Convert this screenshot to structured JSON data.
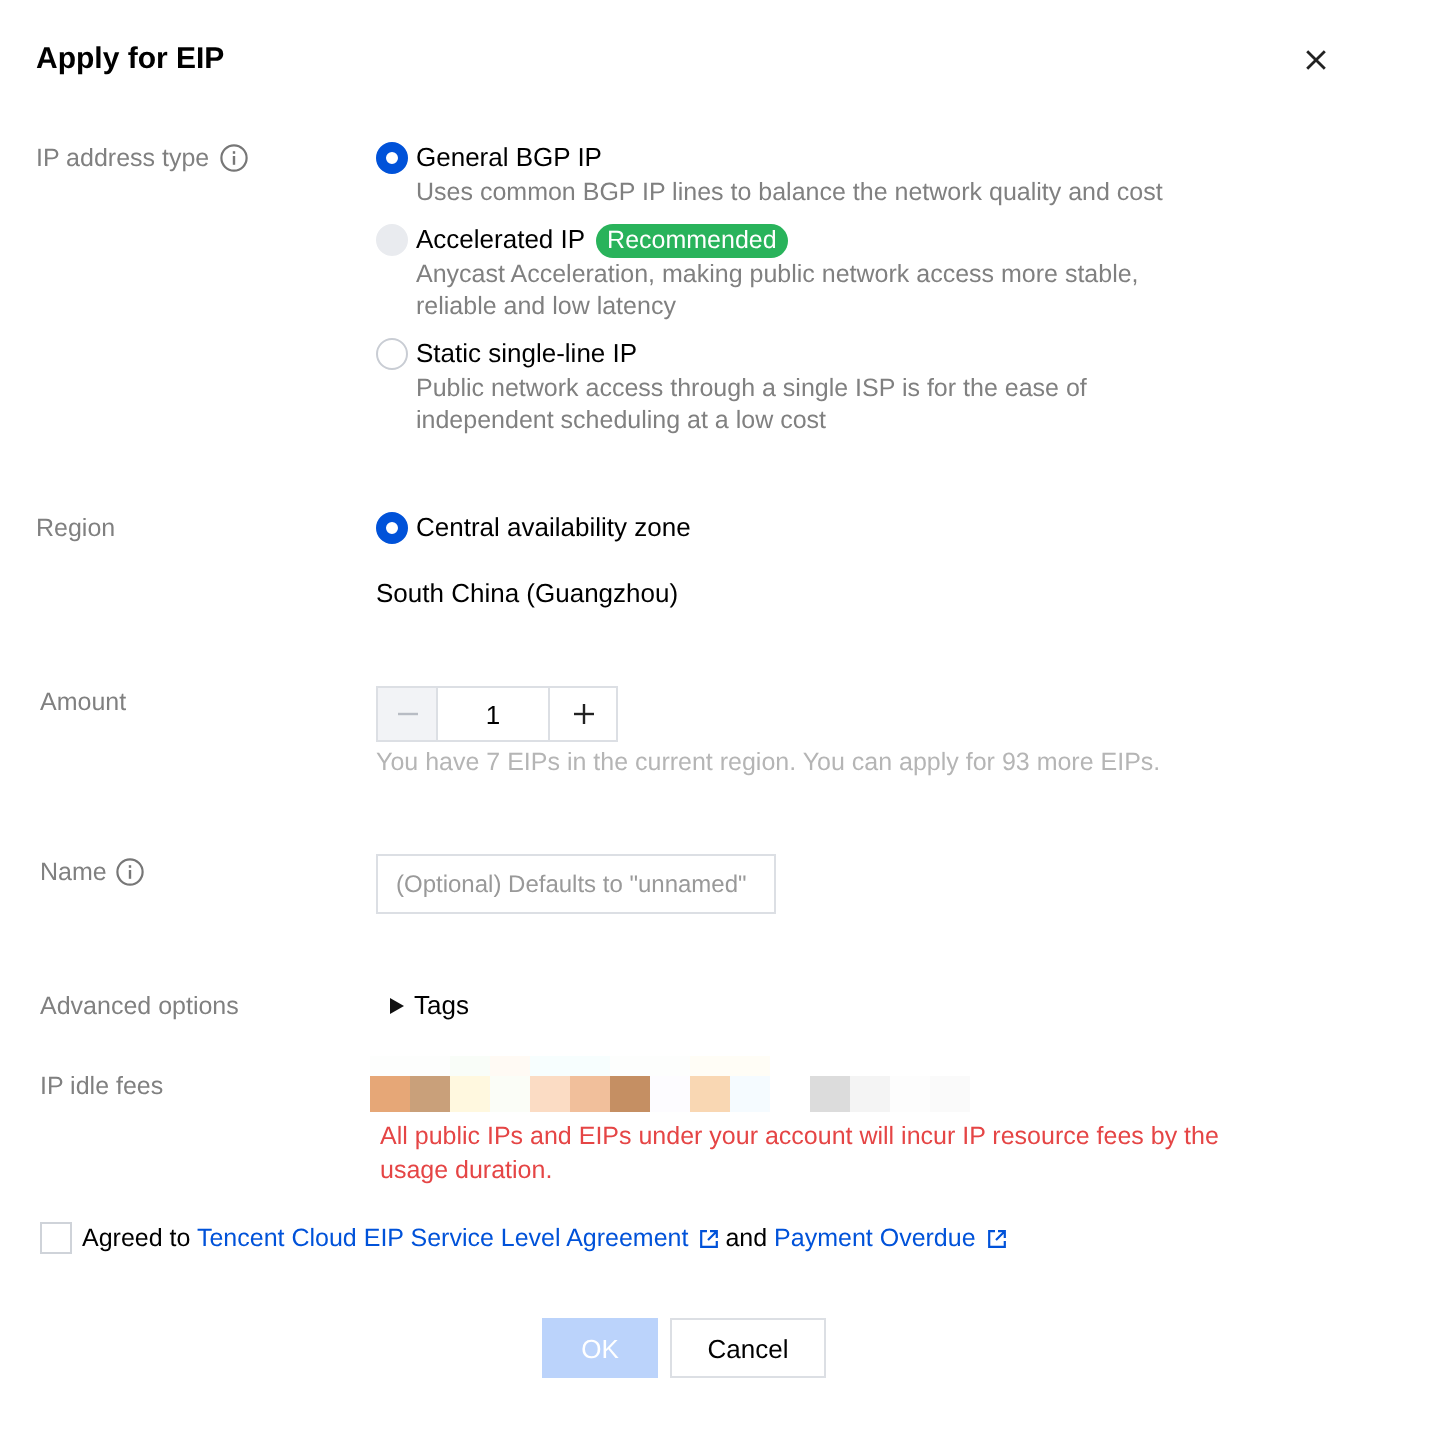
{
  "dialog": {
    "title": "Apply for EIP"
  },
  "ip_address_type": {
    "label": "IP address type",
    "info": true,
    "options": [
      {
        "label": "General BGP IP",
        "description": "Uses common BGP IP lines to balance the network quality and cost",
        "selected": true,
        "disabled": false
      },
      {
        "label": "Accelerated IP",
        "badge": "Recommended",
        "description": "Anycast Acceleration, making public network access more stable, reliable and low latency",
        "selected": false,
        "disabled": true
      },
      {
        "label": "Static single-line IP",
        "description": "Public network access through a single ISP is for the ease of independent scheduling at a low cost",
        "selected": false,
        "disabled": false
      }
    ]
  },
  "region": {
    "label": "Region",
    "options": [
      {
        "label": "Central availability zone",
        "selected": true
      }
    ],
    "value": "South China (Guangzhou)"
  },
  "amount": {
    "label": "Amount",
    "value": "1",
    "decrement_disabled": true,
    "hint": "You have 7 EIPs in the current region. You can apply for 93 more EIPs."
  },
  "name": {
    "label": "Name",
    "info": true,
    "placeholder": "(Optional) Defaults to \"unnamed\""
  },
  "advanced_options": {
    "label": "Advanced options",
    "toggle": "Tags",
    "expanded": false
  },
  "ip_idle_fees": {
    "label": "IP idle fees",
    "warning": "All public IPs and EIPs under your account will incur IP resource fees by the usage duration."
  },
  "agreement": {
    "checked": false,
    "segments": [
      {
        "kind": "text",
        "text": "Agreed to"
      },
      {
        "kind": "link",
        "text": "Tencent Cloud EIP Service Level Agreement"
      },
      {
        "kind": "text",
        "text": "and"
      },
      {
        "kind": "link",
        "text": "Payment Overdue"
      }
    ]
  },
  "buttons": [
    {
      "label": "OK",
      "kind": "primary",
      "disabled": true
    },
    {
      "label": "Cancel",
      "kind": "secondary",
      "disabled": false
    }
  ]
}
